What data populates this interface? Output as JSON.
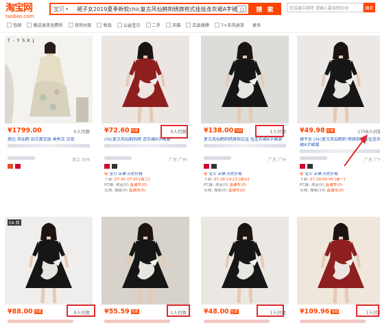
{
  "header": {
    "logo_cn": "淘宝网",
    "logo_en": "taobao.com",
    "search_scope": "宝贝",
    "search_query": "裙子女2019夏季新款chic复古风仙鹤刺绣旗袍式挂挂连衣裙A字裙潮",
    "search_button": "搜 索",
    "shop_search_placeholder": "在结果中排除  请输入要排除的词",
    "shop_search_button": "确定"
  },
  "filters": [
    "包邮",
    "赠送退货运费险",
    "货到付款",
    "新品",
    "公益宝贝",
    "二手",
    "天猫",
    "正品保障",
    "7+天内退货"
  ],
  "filters_more": "更多",
  "products": [
    {
      "price": "¥1799.00",
      "sold": "0人付款",
      "title": "蔹比   风仙鹤   刻王面又版 画秀又   日宵",
      "shop": "",
      "loc": "浙江 台州",
      "meta": []
    },
    {
      "price": "¥72.60",
      "badge": "包邮",
      "sold": "0人付款",
      "title": "   chic复古风仙鹤刺绣 连衣裙A字裙潮",
      "shop": "",
      "loc": "广东 广州",
      "meta": [
        "促",
        [
          "下架:",
          "07-30 07:30 [周二]"
        ],
        [
          "PC端: 淘宝(0)",
          "直通车(0)"
        ],
        [
          "无线: 搜索(0)",
          "直通车(0)"
        ]
      ]
    },
    {
      "price": "¥138.00",
      "badge": "包邮",
      "sold": "1人付款",
      "title": "   复古风仙鹤刺绣旗袍式挂 挂连衣裙A字裙潮",
      "shop": "",
      "loc": "广东 广州",
      "meta": [
        "促",
        [
          "下架:",
          "07-28 14:23 [周日]"
        ],
        [
          "PC端: 淘宝(0)",
          "直通车(0)"
        ],
        [
          "无线: 搜索(0)",
          "直通车(0)"
        ]
      ]
    },
    {
      "price": "¥49.98",
      "badge": "包邮",
      "sold": "1758人付款",
      "title": "裙子女   chic复古风仙鹤刺 绣旗袍式挂挂连衣裙A字裙潮",
      "shop": "",
      "loc": "广东 广州",
      "meta": [
        "促",
        [
          "下架:",
          "07-29 04:45 [周一]"
        ],
        [
          "PC端: 淘宝(0)",
          "直通车(0)"
        ],
        [
          "无线: 搜索(14)",
          "直通车(0)"
        ]
      ]
    },
    {
      "price": "¥88.00",
      "badge": "包邮",
      "sold": "9人付款",
      "title": "",
      "shop": "",
      "loc": "",
      "meta": []
    },
    {
      "price": "¥55.59",
      "badge": "包邮",
      "sold": "1人付款",
      "title": "",
      "shop": "",
      "loc": "",
      "meta": []
    },
    {
      "price": "¥48.00",
      "badge": "包邮",
      "sold": "1人付款",
      "title": "",
      "shop": "",
      "loc": "",
      "meta": []
    },
    {
      "price": "¥109.96",
      "badge": "包邮",
      "sold": "1人付款",
      "title": "",
      "shop": "",
      "loc": "",
      "meta": []
    }
  ],
  "meta_links": "宝贝 店铺 历史价格",
  "overlay_text": [
    "T - Y S K J",
    "EA 简"
  ],
  "colors": {
    "accent": "#ff4400",
    "highlight_box": "#e0282e",
    "link": "#2a5db0"
  }
}
